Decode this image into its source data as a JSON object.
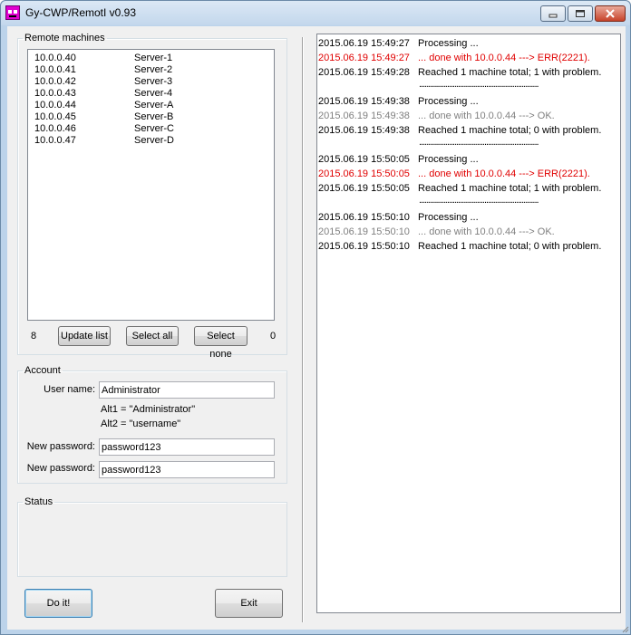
{
  "window": {
    "title": "Gy-CWP/RemotI  v0.93",
    "minimize_icon": "minimize-icon",
    "maximize_icon": "maximize-icon",
    "close_icon": "close-icon"
  },
  "machines": {
    "legend": "Remote machines",
    "items": [
      {
        "ip": "10.0.0.40",
        "name": "Server-1"
      },
      {
        "ip": "10.0.0.41",
        "name": "Server-2"
      },
      {
        "ip": "10.0.0.42",
        "name": "Server-3"
      },
      {
        "ip": "10.0.0.43",
        "name": "Server-4"
      },
      {
        "ip": "10.0.0.44",
        "name": "Server-A"
      },
      {
        "ip": "10.0.0.45",
        "name": "Server-B"
      },
      {
        "ip": "10.0.0.46",
        "name": "Server-C"
      },
      {
        "ip": "10.0.0.47",
        "name": "Server-D"
      }
    ],
    "total_count": "8",
    "selected_count": "0",
    "update_label": "Update list",
    "select_all_label": "Select all",
    "select_none_label": "Select none"
  },
  "account": {
    "legend": "Account",
    "user_label": "User name:",
    "user_value": "Administrator",
    "alt1": "Alt1 = \"Administrator\"",
    "alt2": "Alt2 = \"username\"",
    "pw1_label": "New password:",
    "pw1_value": "password123",
    "pw2_label": "New password:",
    "pw2_value": "password123"
  },
  "status": {
    "legend": "Status"
  },
  "actions": {
    "doit_label": "Do it!",
    "exit_label": "Exit"
  },
  "log": {
    "colors": {
      "normal": "#000000",
      "error": "#e00000",
      "ok": "#808080"
    },
    "separator_text": "................................................................",
    "lines": [
      {
        "ts": "2015.06.19 15:49:27",
        "msg": "Processing ...",
        "kind": "normal"
      },
      {
        "ts": "2015.06.19 15:49:27",
        "msg": "... done with 10.0.0.44 ---> ERR(2221).",
        "kind": "error"
      },
      {
        "ts": "2015.06.19 15:49:28",
        "msg": "Reached 1 machine total; 1 with problem.",
        "kind": "normal"
      },
      {
        "ts": "",
        "msg": "",
        "kind": "separator"
      },
      {
        "ts": "2015.06.19 15:49:38",
        "msg": "Processing ...",
        "kind": "normal"
      },
      {
        "ts": "2015.06.19 15:49:38",
        "msg": "... done with 10.0.0.44 ---> OK.",
        "kind": "ok"
      },
      {
        "ts": "2015.06.19 15:49:38",
        "msg": "Reached 1 machine total; 0 with problem.",
        "kind": "normal"
      },
      {
        "ts": "",
        "msg": "",
        "kind": "separator"
      },
      {
        "ts": "2015.06.19 15:50:05",
        "msg": "Processing ...",
        "kind": "normal"
      },
      {
        "ts": "2015.06.19 15:50:05",
        "msg": "... done with 10.0.0.44 ---> ERR(2221).",
        "kind": "error"
      },
      {
        "ts": "2015.06.19 15:50:05",
        "msg": "Reached 1 machine total; 1 with problem.",
        "kind": "normal"
      },
      {
        "ts": "",
        "msg": "",
        "kind": "separator"
      },
      {
        "ts": "2015.06.19 15:50:10",
        "msg": "Processing ...",
        "kind": "normal"
      },
      {
        "ts": "2015.06.19 15:50:10",
        "msg": "... done with 10.0.0.44 ---> OK.",
        "kind": "ok"
      },
      {
        "ts": "2015.06.19 15:50:10",
        "msg": "Reached 1 machine total; 0 with problem.",
        "kind": "normal"
      }
    ]
  }
}
